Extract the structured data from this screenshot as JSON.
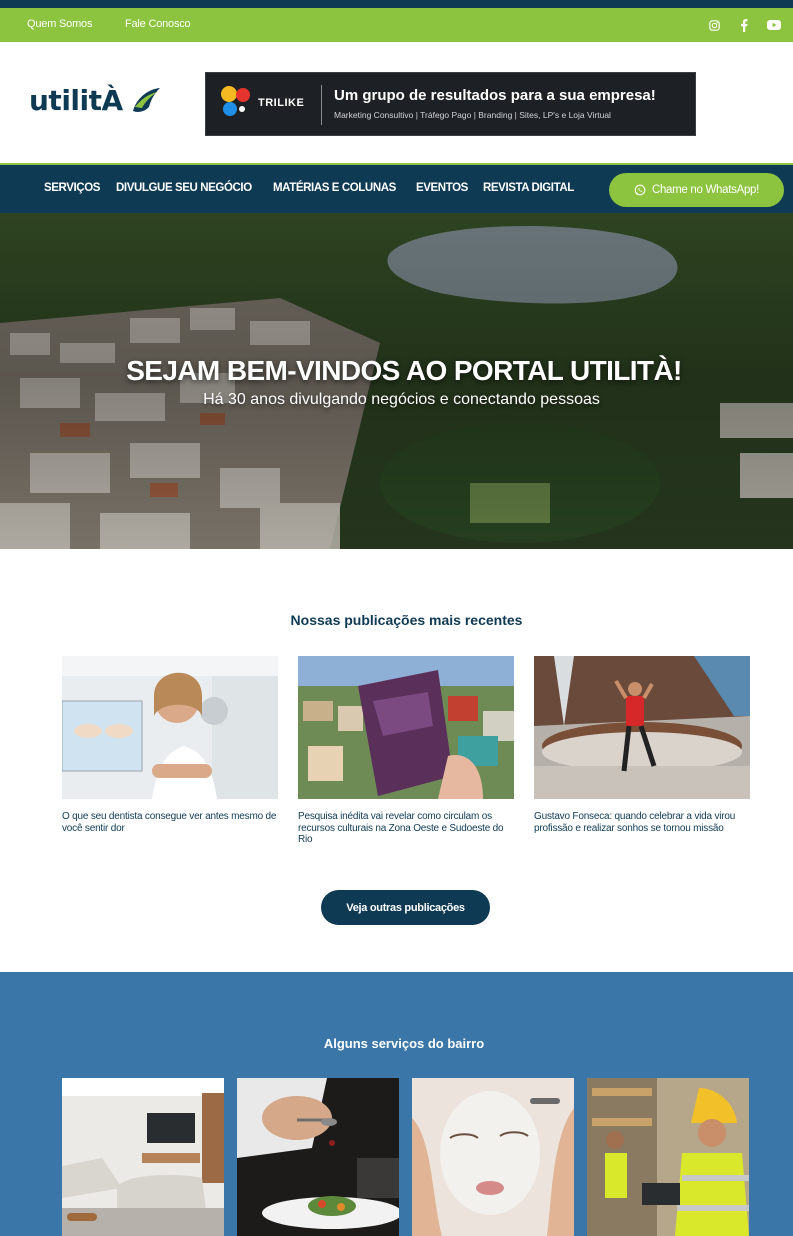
{
  "topbar": {
    "links": [
      "Quem Somos",
      "Fale Conosco"
    ],
    "social_icons": [
      "instagram-icon",
      "facebook-icon",
      "youtube-icon"
    ]
  },
  "header": {
    "logo_text": "utilitÀ",
    "banner": {
      "brand": "TRILIKE",
      "headline": "Um grupo de resultados para a sua empresa!",
      "subline": "Marketing Consultivo | Tráfego Pago | Branding | Sites, LP's e Loja Virtual"
    }
  },
  "nav": {
    "items": [
      "SERVIÇOS",
      "DIVULGUE SEU NEGÓCIO",
      "MATÉRIAS E COLUNAS",
      "EVENTOS",
      "REVISTA DIGITAL"
    ],
    "whatsapp_label": "Chame no WhatsApp!"
  },
  "hero": {
    "title": "SEJAM BEM-VINDOS AO PORTAL UTILITÀ!",
    "subtitle": "Há 30 anos divulgando negócios e conectando pessoas"
  },
  "publications": {
    "title": "Nossas publicações mais recentes",
    "items": [
      "O que seu dentista consegue ver antes mesmo de você sentir dor",
      "Pesquisa inédita vai revelar como circulam os recursos culturais na Zona Oeste e Sudoeste do Rio",
      "Gustavo Fonseca: quando celebrar a vida virou profissão e realizar sonhos se tornou missão"
    ],
    "more_button": "Veja outras publicações"
  },
  "services": {
    "title": "Alguns serviços do bairro"
  },
  "colors": {
    "navy": "#0f3a54",
    "green": "#8dc43f",
    "blue_section": "#3a76a7"
  }
}
